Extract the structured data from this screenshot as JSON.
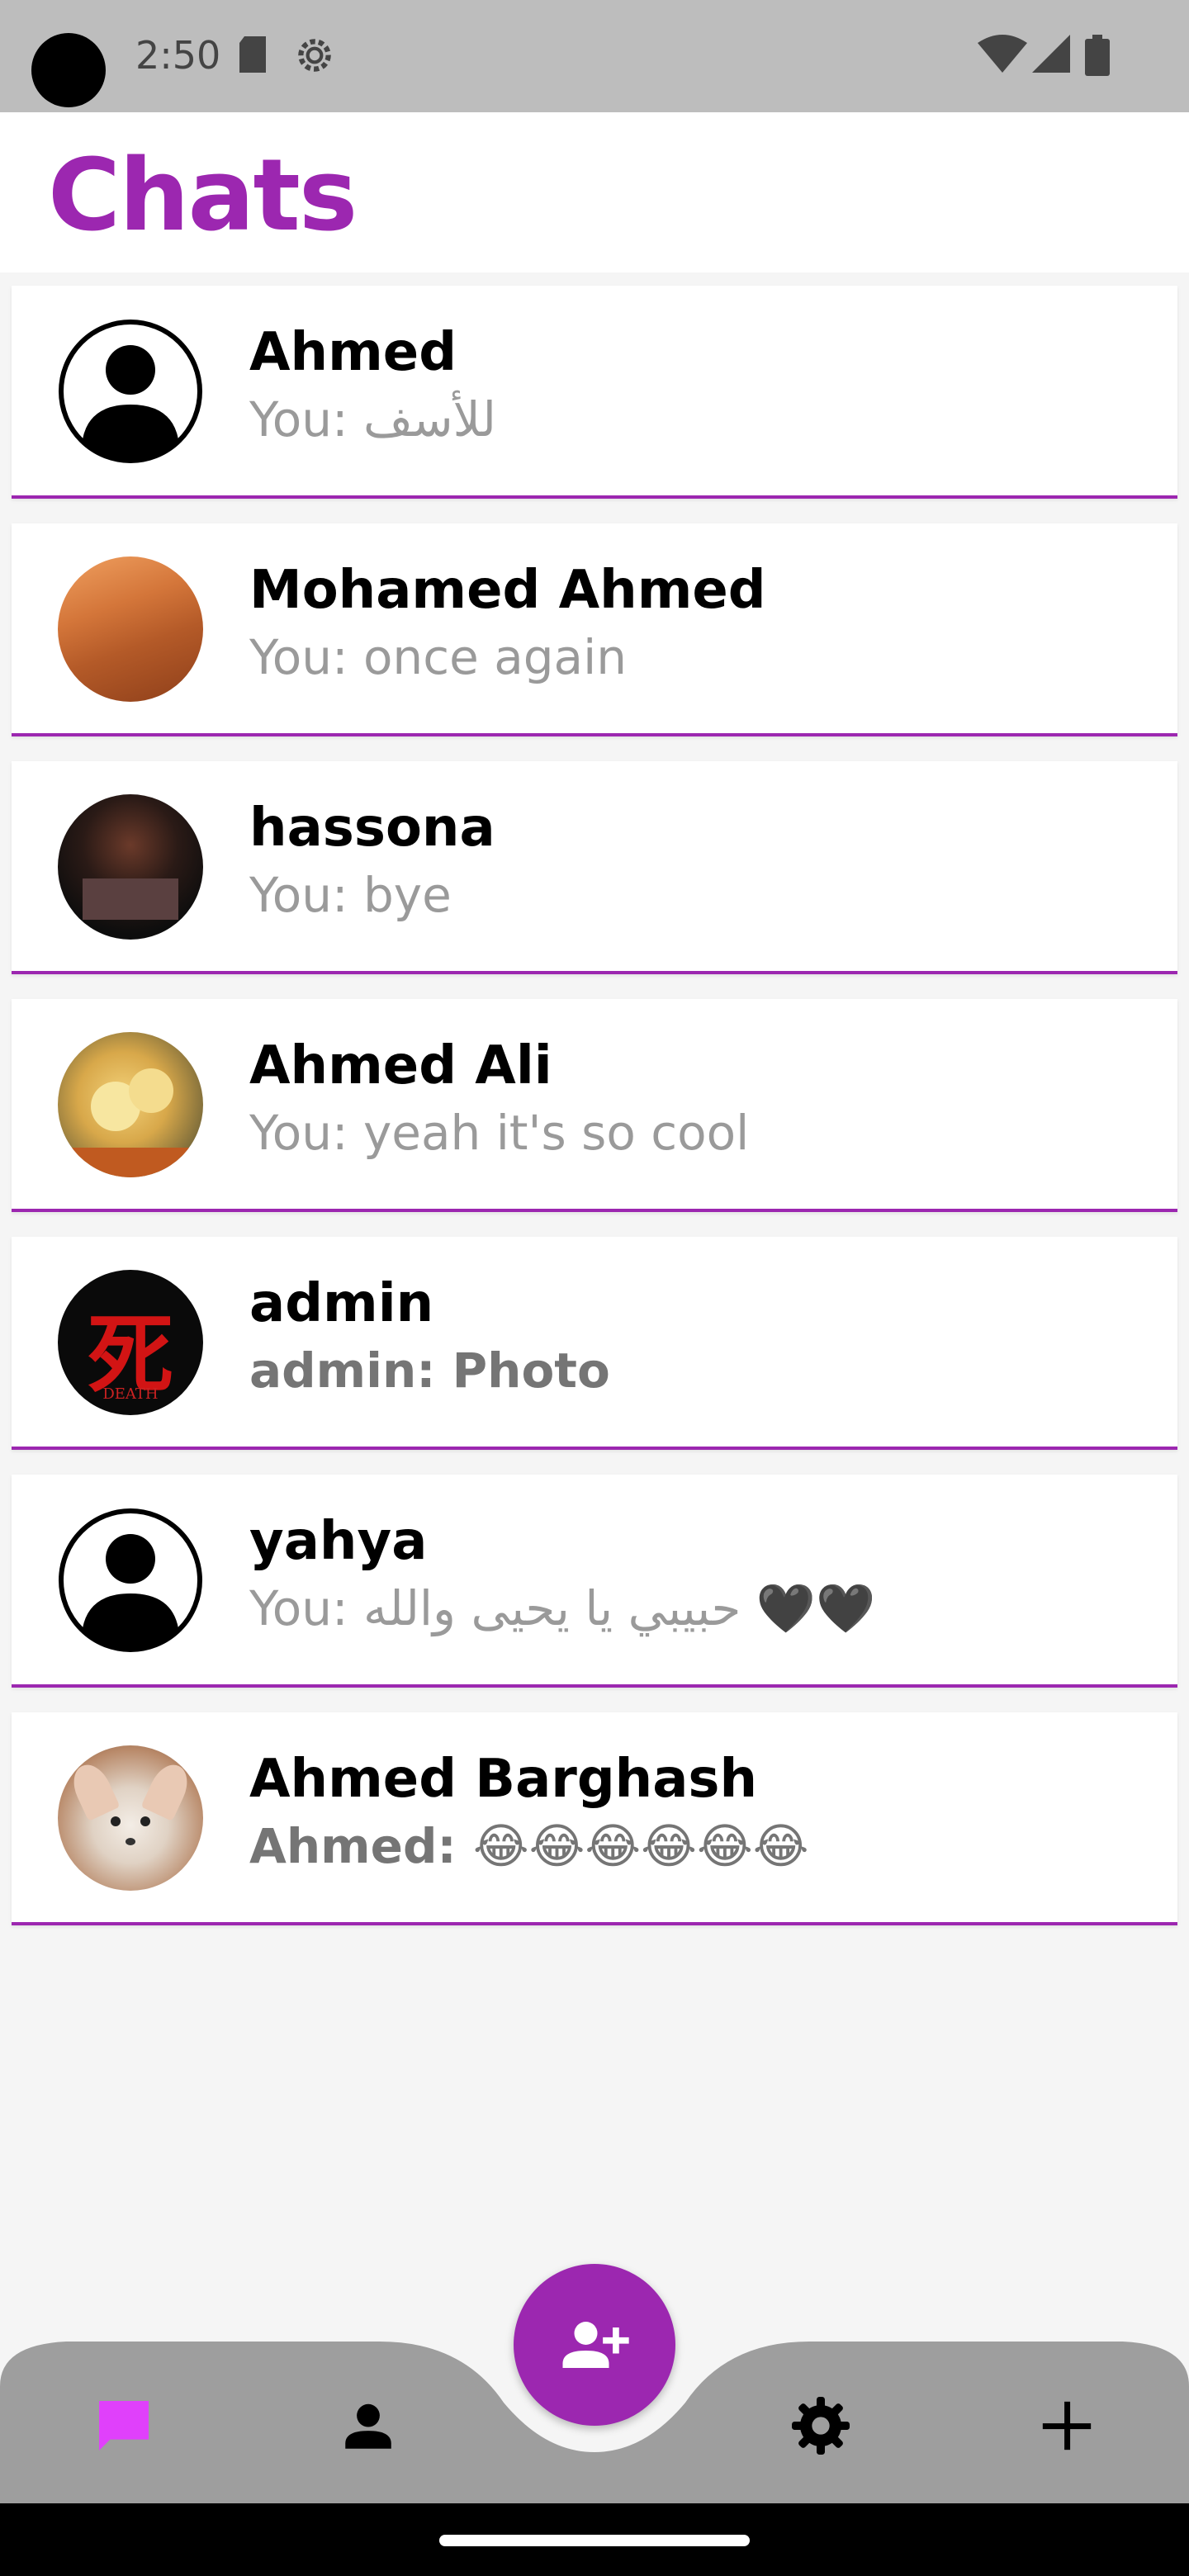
{
  "status_bar": {
    "time": "2:50",
    "icons": [
      "sd-card-icon",
      "settings-gear-icon",
      "wifi-icon",
      "signal-icon",
      "battery-icon"
    ]
  },
  "header": {
    "title": "Chats"
  },
  "chats": [
    {
      "name": "Ahmed",
      "message": "You: للأسف",
      "avatar": "default-person-avatar"
    },
    {
      "name": "Mohamed Ahmed",
      "message": "You: once again",
      "avatar": "desert-photo-avatar"
    },
    {
      "name": "hassona",
      "message": "You: bye",
      "avatar": "dark-photo-avatar"
    },
    {
      "name": "Ahmed Ali",
      "message": "You: yeah it's so cool",
      "avatar": "chicks-photo-avatar"
    },
    {
      "name": "admin",
      "message": "admin: Photo",
      "avatar": "death-kanji-avatar"
    },
    {
      "name": "yahya",
      "message": "You: حبيبي يا يحيى والله 🖤🖤",
      "avatar": "default-person-avatar"
    },
    {
      "name": "Ahmed Barghash",
      "message": "Ahmed: 😂😂😂😂😂😂",
      "avatar": "fox-photo-avatar"
    }
  ],
  "bottom_nav": {
    "items": [
      "chat-icon",
      "person-icon",
      "settings-icon",
      "add-icon"
    ],
    "fab": "add-person-icon",
    "active_color": "#e040fb"
  },
  "colors": {
    "accent": "#9c27b0",
    "navbar": "#9e9e9e"
  }
}
